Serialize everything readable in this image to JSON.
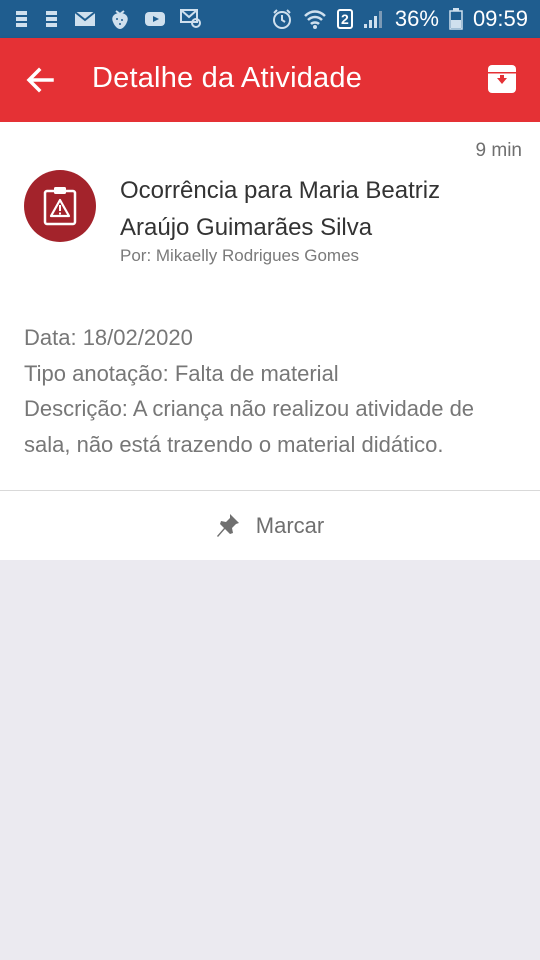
{
  "status_bar": {
    "battery": "36%",
    "time": "09:59",
    "sim": "2",
    "left_icons": [
      "notification-icon",
      "notification-icon",
      "mail-icon",
      "strawberry-icon",
      "youtube-icon",
      "email-at-icon"
    ],
    "right_icons": [
      "alarm-icon",
      "wifi-icon",
      "sim-icon",
      "signal-icon",
      "battery-icon"
    ]
  },
  "app_bar": {
    "title": "Detalhe da Atividade",
    "back_icon": "arrow-left-icon",
    "action_icon": "archive-icon",
    "color": "#e53135"
  },
  "activity": {
    "time": "9 min",
    "icon": "clipboard-warning-icon",
    "icon_bg": "#a3232b",
    "title": "Ocorrência para Maria Beatriz Araújo Guimarães Silva",
    "author": "Por: Mikaelly Rodrigues Gomes",
    "date_line": "Data: 18/02/2020",
    "type_line": "Tipo anotação: Falta de material",
    "description_line": "Descrição: A criança não realizou atividade de sala, não está trazendo o material didático."
  },
  "mark_button": {
    "label": "Marcar",
    "icon": "pin-icon"
  }
}
